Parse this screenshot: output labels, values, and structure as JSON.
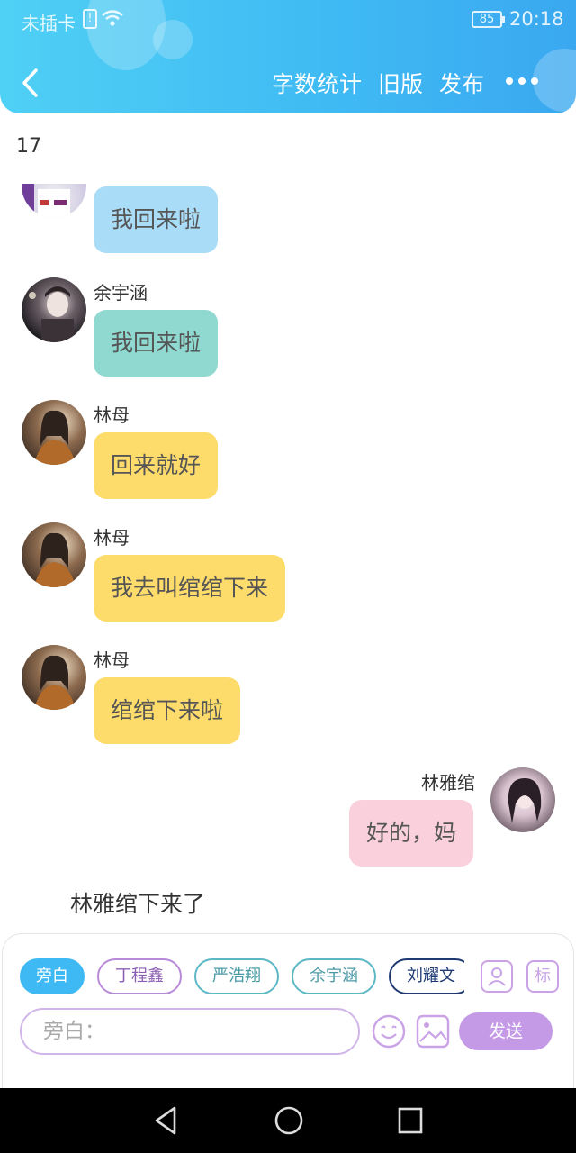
{
  "status_bar": {
    "carrier": "未插卡",
    "sim_glyph": "!",
    "battery": "85",
    "time": "20:18"
  },
  "header": {
    "actions": [
      "字数统计",
      "旧版",
      "发布"
    ]
  },
  "word_count": "17",
  "messages": [
    {
      "sender": "",
      "text": "我回来啦",
      "side": "left",
      "color": "#a9dcf7"
    },
    {
      "sender": "余宇涵",
      "text": "我回来啦",
      "side": "left",
      "color": "#8fd9d0"
    },
    {
      "sender": "林母",
      "text": "回来就好",
      "side": "left",
      "color": "#fddc6b"
    },
    {
      "sender": "林母",
      "text": "我去叫绾绾下来",
      "side": "left",
      "color": "#fddc6b"
    },
    {
      "sender": "林母",
      "text": "绾绾下来啦",
      "side": "left",
      "color": "#fddc6b"
    },
    {
      "sender": "林雅绾",
      "text": "好的，妈",
      "side": "right",
      "color": "#f9d0dc"
    }
  ],
  "narration": "林雅绾下来了",
  "roles": [
    {
      "label": "旁白",
      "color": "#3fb9f3",
      "active": true
    },
    {
      "label": "丁程鑫",
      "color": "#b98ad8"
    },
    {
      "label": "严浩翔",
      "color": "#5bb8c4"
    },
    {
      "label": "余宇涵",
      "color": "#5bb8c4"
    },
    {
      "label": "刘耀文",
      "color": "#1f3a73"
    }
  ],
  "tag_button": "标",
  "input_placeholder": "旁白：",
  "send_label": "发送"
}
